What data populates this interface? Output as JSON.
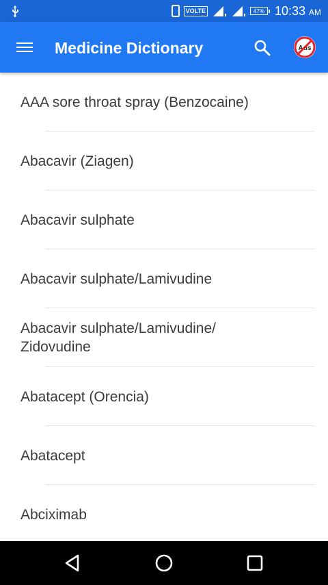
{
  "status_bar": {
    "volte": "VOLTE",
    "battery": "47%",
    "time": "10:33",
    "ampm": "AM",
    "icons": [
      "usb-icon",
      "phone-icon",
      "signal-icon",
      "signal-icon",
      "battery-icon"
    ]
  },
  "app_bar": {
    "title": "Medicine Dictionary",
    "menu_icon": "hamburger-menu-icon",
    "search_icon": "search-icon",
    "no_ads_label": "Ads",
    "background": "#2079f2"
  },
  "medicines": [
    "AAA sore throat spray (Benzocaine)",
    "Abacavir (Ziagen)",
    "Abacavir sulphate",
    "Abacavir sulphate/Lamivudine",
    "Abacavir sulphate/Lamivudine/\nZidovudine",
    "Abatacept (Orencia)",
    "Abatacept",
    "Abciximab"
  ],
  "nav_bar": {
    "icons": [
      "back-icon",
      "home-icon",
      "recents-icon"
    ]
  }
}
